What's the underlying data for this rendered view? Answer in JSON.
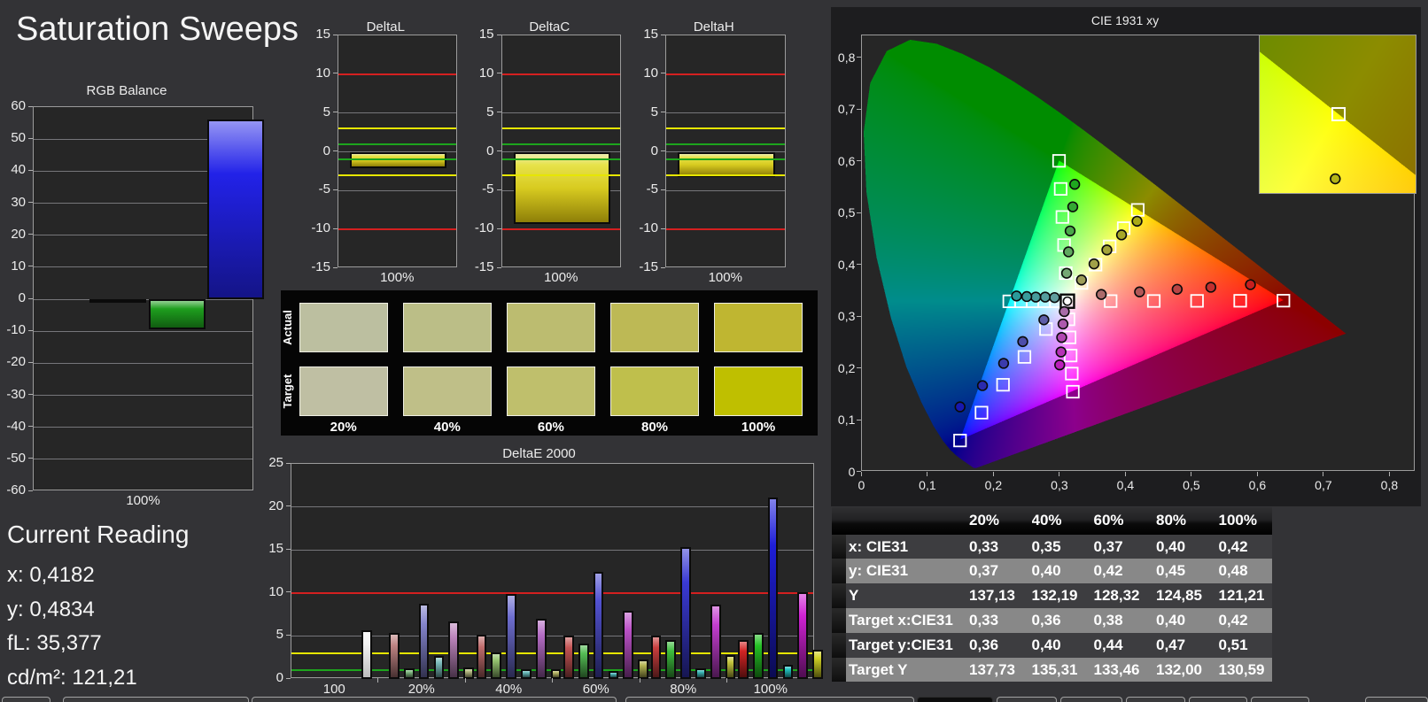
{
  "page": {
    "title": "Saturation Sweeps"
  },
  "current_reading": {
    "title": "Current Reading",
    "lines": [
      "x: 0,4182",
      "y: 0,4834",
      "fL: 35,377",
      "cd/m²: 121,21"
    ]
  },
  "chart_data": [
    {
      "id": "rgb_balance",
      "type": "bar",
      "title": "RGB Balance",
      "categories": [
        "100%"
      ],
      "xlabel": "100%",
      "ylim": [
        -60,
        60
      ],
      "ytick_step": 10,
      "grid": true,
      "series": [
        {
          "name": "red",
          "values": [
            -0.3
          ],
          "color": "#cc2222"
        },
        {
          "name": "green",
          "values": [
            -9.4
          ],
          "color": "#1e9e1e"
        },
        {
          "name": "blue",
          "values": [
            56.0
          ],
          "color": "#2222e8"
        }
      ]
    },
    {
      "id": "deltaL",
      "type": "bar",
      "title": "DeltaL",
      "categories": [
        "100%"
      ],
      "xlabel": "100%",
      "ylim": [
        -15,
        15
      ],
      "ytick_step": 5,
      "grid": true,
      "values": [
        -2.1
      ],
      "bar_color": "#e2e23c",
      "limit_lines": [
        {
          "value": 10,
          "color": "#d42020"
        },
        {
          "value": -10,
          "color": "#d42020"
        },
        {
          "value": 3,
          "color": "#e6e600"
        },
        {
          "value": -3,
          "color": "#e6e600"
        },
        {
          "value": 1,
          "color": "#1da51d"
        },
        {
          "value": -1,
          "color": "#1da51d"
        }
      ]
    },
    {
      "id": "deltaC",
      "type": "bar",
      "title": "DeltaC",
      "categories": [
        "100%"
      ],
      "xlabel": "100%",
      "ylim": [
        -15,
        15
      ],
      "ytick_step": 5,
      "grid": true,
      "values": [
        -9.35
      ],
      "bar_color": "#e2e23c",
      "limit_lines": [
        {
          "value": 10,
          "color": "#d42020"
        },
        {
          "value": -10,
          "color": "#d42020"
        },
        {
          "value": 3,
          "color": "#e6e600"
        },
        {
          "value": -3,
          "color": "#e6e600"
        },
        {
          "value": 1,
          "color": "#1da51d"
        },
        {
          "value": -1,
          "color": "#1da51d"
        }
      ]
    },
    {
      "id": "deltaH",
      "type": "bar",
      "title": "DeltaH",
      "categories": [
        "100%"
      ],
      "xlabel": "100%",
      "ylim": [
        -15,
        15
      ],
      "ytick_step": 5,
      "grid": true,
      "values": [
        -3.3
      ],
      "bar_color": "#e2e23c",
      "limit_lines": [
        {
          "value": 10,
          "color": "#d42020"
        },
        {
          "value": -10,
          "color": "#d42020"
        },
        {
          "value": 3,
          "color": "#e6e600"
        },
        {
          "value": -3,
          "color": "#e6e600"
        },
        {
          "value": 1,
          "color": "#1da51d"
        },
        {
          "value": -1,
          "color": "#1da51d"
        }
      ]
    },
    {
      "id": "deltae2000",
      "type": "bar",
      "title": "DeltaE 2000",
      "ylim": [
        0,
        25
      ],
      "ytick_step": 5,
      "grid": true,
      "limit_lines": [
        {
          "value": 10,
          "color": "#d42020"
        },
        {
          "value": 3,
          "color": "#e6e600"
        },
        {
          "value": 1,
          "color": "#1da51d"
        }
      ],
      "categories": [
        "100",
        "20%",
        "40%",
        "60%",
        "80%",
        "100%"
      ],
      "groups": [
        {
          "label": "100",
          "bars": [
            {
              "name": "white",
              "value": 5.7,
              "color": "#f2f2f2",
              "slot": 4
            }
          ]
        },
        {
          "label": "20%",
          "bars": [
            {
              "name": "red",
              "value": 5.3,
              "color": "#bd8282",
              "slot": 0
            },
            {
              "name": "green",
              "value": 1.2,
              "color": "#84bc84",
              "slot": 1
            },
            {
              "name": "blue",
              "value": 8.7,
              "color": "#8484cc",
              "slot": 2
            },
            {
              "name": "cyan",
              "value": 2.7,
              "color": "#7cbcbc",
              "slot": 3
            },
            {
              "name": "magenta",
              "value": 6.65,
              "color": "#bc84bc",
              "slot": 4
            },
            {
              "name": "yellow",
              "value": 1.35,
              "color": "#b9bc84",
              "slot": 5
            }
          ]
        },
        {
          "label": "40%",
          "bars": [
            {
              "name": "red",
              "value": 5.15,
              "color": "#c06c6c",
              "slot": 0
            },
            {
              "name": "green",
              "value": 3.1,
              "color": "#96c470",
              "slot": 1
            },
            {
              "name": "blue",
              "value": 9.85,
              "color": "#6e6ed0",
              "slot": 2
            },
            {
              "name": "cyan",
              "value": 1.1,
              "color": "#68bcbc",
              "slot": 3
            },
            {
              "name": "magenta",
              "value": 6.95,
              "color": "#b46cc4",
              "slot": 4
            },
            {
              "name": "yellow",
              "value": 1.1,
              "color": "#bcbc6a",
              "slot": 5
            }
          ]
        },
        {
          "label": "60%",
          "bars": [
            {
              "name": "red",
              "value": 5.0,
              "color": "#c45454",
              "slot": 0
            },
            {
              "name": "green",
              "value": 4.15,
              "color": "#54bc54",
              "slot": 1
            },
            {
              "name": "blue",
              "value": 12.45,
              "color": "#5252d2",
              "slot": 2
            },
            {
              "name": "cyan",
              "value": 0.95,
              "color": "#50bcbc",
              "slot": 3
            },
            {
              "name": "magenta",
              "value": 7.9,
              "color": "#bc52c8",
              "slot": 4
            },
            {
              "name": "yellow",
              "value": 2.3,
              "color": "#b4b452",
              "slot": 5
            }
          ]
        },
        {
          "label": "80%",
          "bars": [
            {
              "name": "red",
              "value": 5.0,
              "color": "#c83e3e",
              "slot": 0
            },
            {
              "name": "green",
              "value": 4.55,
              "color": "#3ebc3e",
              "slot": 1
            },
            {
              "name": "blue",
              "value": 15.3,
              "color": "#3a3ad4",
              "slot": 2
            },
            {
              "name": "cyan",
              "value": 1.2,
              "color": "#3ebcbc",
              "slot": 3
            },
            {
              "name": "magenta",
              "value": 8.6,
              "color": "#c43ed0",
              "slot": 4
            },
            {
              "name": "yellow",
              "value": 2.75,
              "color": "#c4c43e",
              "slot": 5
            }
          ]
        },
        {
          "label": "100%",
          "bars": [
            {
              "name": "red",
              "value": 4.5,
              "color": "#d22424",
              "slot": 0
            },
            {
              "name": "green",
              "value": 5.4,
              "color": "#24c024",
              "slot": 1
            },
            {
              "name": "blue",
              "value": 21.1,
              "color": "#1e1ed8",
              "slot": 2
            },
            {
              "name": "cyan",
              "value": 1.65,
              "color": "#24c4c4",
              "slot": 3
            },
            {
              "name": "magenta",
              "value": 10.1,
              "color": "#d022d4",
              "slot": 4
            },
            {
              "name": "yellow",
              "value": 3.4,
              "color": "#d0d024",
              "slot": 5
            }
          ]
        }
      ]
    },
    {
      "id": "cie1931",
      "type": "scatter",
      "title": "CIE 1931 xy",
      "xlim": [
        0,
        0.8388
      ],
      "ylim": [
        0,
        0.8441
      ],
      "x_ticks": [
        "0",
        "0,1",
        "0,2",
        "0,3",
        "0,4",
        "0,5",
        "0,6",
        "0,7",
        "0,8"
      ],
      "y_ticks": [
        "0",
        "0,1",
        "0,2",
        "0,3",
        "0,4",
        "0,5",
        "0,6",
        "0,7",
        "0,8"
      ],
      "gamut_triangle": {
        "red": [
          0.64,
          0.33
        ],
        "green": [
          0.3,
          0.6
        ],
        "blue": [
          0.15,
          0.06
        ]
      },
      "white_point": {
        "target": [
          0.3127,
          0.329
        ],
        "measured": [
          0.3127,
          0.329
        ]
      },
      "sweeps": {
        "red": {
          "targets": [
            [
              0.3782,
              0.3292
            ],
            [
              0.4436,
              0.3294
            ],
            [
              0.5091,
              0.3296
            ],
            [
              0.5745,
              0.3298
            ],
            [
              0.64,
              0.33
            ]
          ],
          "measured": [
            [
              0.364,
              0.342
            ],
            [
              0.422,
              0.347
            ],
            [
              0.479,
              0.352
            ],
            [
              0.53,
              0.356
            ],
            [
              0.59,
              0.361
            ]
          ],
          "point_colors": [
            "#ab6b6b",
            "#b25858",
            "#b94444",
            "#c03030",
            "#c61f1f"
          ]
        },
        "green": {
          "targets": [
            [
              0.3102,
              0.3832
            ],
            [
              0.3076,
              0.4374
            ],
            [
              0.3051,
              0.4916
            ],
            [
              0.3025,
              0.5458
            ],
            [
              0.3,
              0.6
            ]
          ],
          "measured": [
            [
              0.3115,
              0.383
            ],
            [
              0.3144,
              0.4243
            ],
            [
              0.3168,
              0.4646
            ],
            [
              0.3208,
              0.5112
            ],
            [
              0.3237,
              0.5547
            ]
          ],
          "point_colors": [
            "#74a874",
            "#5fa85f",
            "#49a849",
            "#33a833",
            "#1fa81f"
          ]
        },
        "blue": {
          "targets": [
            [
              0.2802,
              0.2752
            ],
            [
              0.2476,
              0.2214
            ],
            [
              0.2151,
              0.1676
            ],
            [
              0.1825,
              0.1138
            ],
            [
              0.15,
              0.06
            ]
          ],
          "measured": [
            [
              0.277,
              0.293
            ],
            [
              0.245,
              0.251
            ],
            [
              0.216,
              0.209
            ],
            [
              0.184,
              0.166
            ],
            [
              0.15,
              0.125
            ]
          ],
          "point_colors": [
            "#5e5ea8",
            "#4d4daa",
            "#3b3bac",
            "#2a2aae",
            "#1818b0"
          ]
        },
        "cyan": {
          "targets": [
            [
              0.2951,
              0.3289
            ],
            [
              0.2775,
              0.3289
            ],
            [
              0.2598,
              0.3288
            ],
            [
              0.2422,
              0.3288
            ],
            [
              0.2246,
              0.3287
            ]
          ],
          "measured": [
            [
              0.2932,
              0.336
            ],
            [
              0.279,
              0.337
            ],
            [
              0.2647,
              0.337
            ],
            [
              0.2511,
              0.338
            ],
            [
              0.2356,
              0.339
            ]
          ],
          "point_colors": [
            "#619e9e",
            "#549d9d",
            "#469c9c",
            "#389b9b",
            "#2a9a9a"
          ]
        },
        "magenta": {
          "targets": [
            [
              0.3143,
              0.294
            ],
            [
              0.316,
              0.2591
            ],
            [
              0.3176,
              0.2241
            ],
            [
              0.3193,
              0.1892
            ],
            [
              0.3209,
              0.1542
            ]
          ],
          "measured": [
            [
              0.308,
              0.309
            ],
            [
              0.306,
              0.285
            ],
            [
              0.304,
              0.259
            ],
            [
              0.303,
              0.231
            ],
            [
              0.301,
              0.206
            ]
          ],
          "point_colors": [
            "#a86ba8",
            "#ad59ad",
            "#b146b1",
            "#b632b6",
            "#bb1fbb"
          ]
        },
        "yellow": {
          "targets": [
            [
              0.334,
              0.3643
            ],
            [
              0.3553,
              0.3995
            ],
            [
              0.3767,
              0.4348
            ],
            [
              0.398,
              0.47
            ],
            [
              0.4193,
              0.5053
            ]
          ],
          "measured": [
            [
              0.334,
              0.37
            ],
            [
              0.353,
              0.401
            ],
            [
              0.3725,
              0.428
            ],
            [
              0.3947,
              0.457
            ],
            [
              0.4182,
              0.4834
            ]
          ],
          "point_colors": [
            "#9e9e58",
            "#a1a148",
            "#a4a438",
            "#a7a728",
            "#aaaa16"
          ]
        }
      },
      "inset": {
        "viewport": {
          "x": [
            0.3927,
            0.4459
          ],
          "y": [
            0.478,
            0.532
          ]
        },
        "target": [
          0.4193,
          0.5053
        ],
        "measured": [
          0.4182,
          0.4834
        ],
        "measured_color": "#b4b418"
      }
    }
  ],
  "swatch_panel": {
    "row_labels": [
      "Actual",
      "Target"
    ],
    "col_labels": [
      "20%",
      "40%",
      "60%",
      "80%",
      "100%"
    ],
    "actual_colors": [
      "#bcbfa0",
      "#bbbe87",
      "#bcbc70",
      "#bdb955",
      "#bfb631"
    ],
    "target_colors": [
      "#bfbfa3",
      "#bfbf88",
      "#bfbf6c",
      "#bfbf4c",
      "#bfbf00"
    ]
  },
  "table": {
    "col_headers": [
      "20%",
      "40%",
      "60%",
      "80%",
      "100%"
    ],
    "rows": [
      {
        "label": "x: CIE31",
        "values": [
          "0,33",
          "0,35",
          "0,37",
          "0,40",
          "0,42"
        ]
      },
      {
        "label": "y: CIE31",
        "values": [
          "0,37",
          "0,40",
          "0,42",
          "0,45",
          "0,48"
        ]
      },
      {
        "label": "Y",
        "values": [
          "137,13",
          "132,19",
          "128,32",
          "124,85",
          "121,21"
        ]
      },
      {
        "label": "Target x:CIE31",
        "values": [
          "0,33",
          "0,36",
          "0,38",
          "0,40",
          "0,42"
        ]
      },
      {
        "label": "Target y:CIE31",
        "values": [
          "0,36",
          "0,40",
          "0,44",
          "0,47",
          "0,51"
        ]
      },
      {
        "label": "Target Y",
        "values": [
          "137,73",
          "135,31",
          "133,46",
          "132,00",
          "130,59"
        ]
      }
    ]
  },
  "colors": {
    "page_bg": "#333336",
    "plot_bg": "#262626",
    "cie_panel_bg": "#1d1d1f",
    "grid": "#76767a",
    "table_row_dark": "#3d3d40",
    "table_row_light": "#888888",
    "table_header_bg": "#0a0a0a"
  }
}
